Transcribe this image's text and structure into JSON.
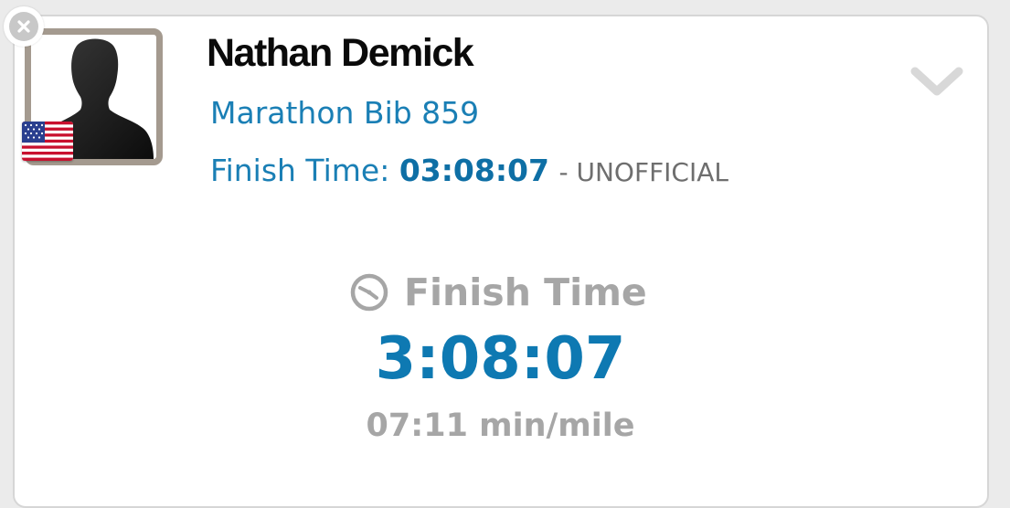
{
  "runner": {
    "name": "Nathan Demick",
    "bib_line": "Marathon Bib 859",
    "finish_label": "Finish Time:",
    "finish_value": "03:08:07",
    "finish_status": "- UNOFFICIAL",
    "country_flag_icon": "us-flag-icon",
    "avatar_icon": "person-silhouette-icon"
  },
  "summary": {
    "label": "Finish Time",
    "icon": "clock-icon",
    "time": "3:08:07",
    "pace": "07:11 min/mile"
  },
  "controls": {
    "close_icon": "close-icon",
    "expand_icon": "chevron-down-icon"
  },
  "colors": {
    "accent": "#1a7fb5",
    "muted": "#a6a6a6",
    "avatar_border": "#a49a8f"
  }
}
